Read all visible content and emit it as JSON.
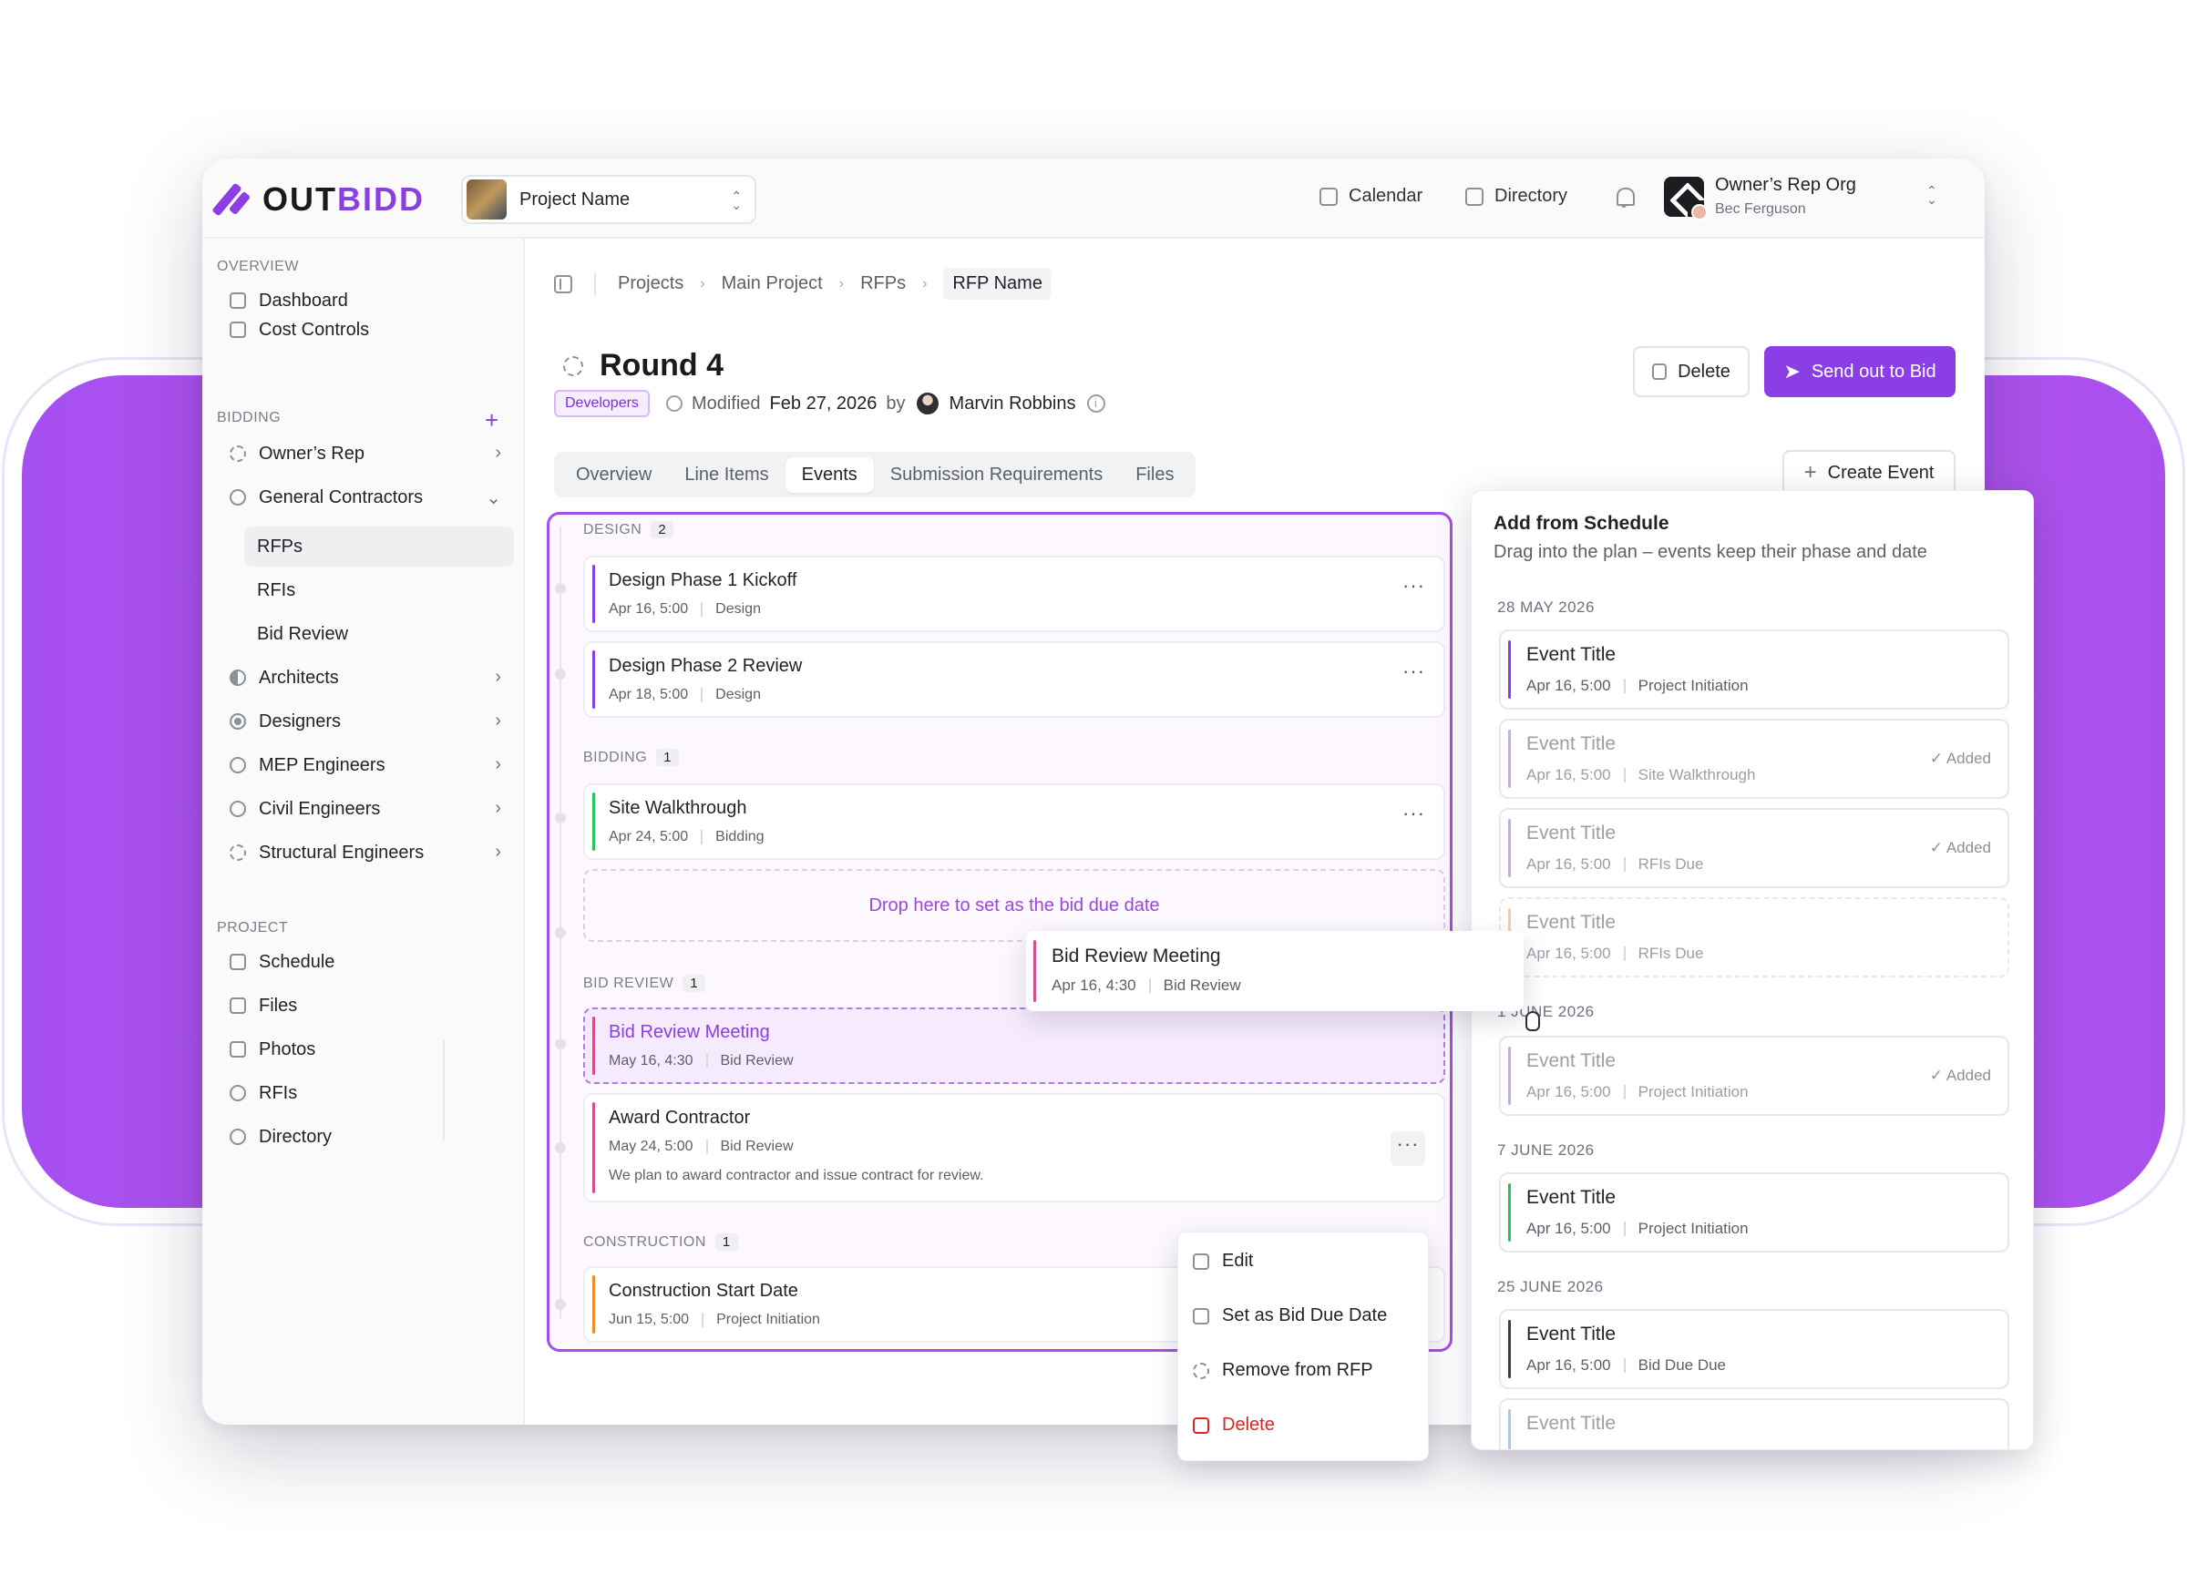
{
  "app": {
    "logo_prefix": "OUT",
    "logo_suffix": "BIDD",
    "accent": "#8b3de6"
  },
  "topbar": {
    "project": "Project Name",
    "calendar": "Calendar",
    "directory": "Directory",
    "org_name": "Owner’s Rep Org",
    "org_user": "Bec Ferguson"
  },
  "sidebar": {
    "overview_h": "OVERVIEW",
    "dashboard": "Dashboard",
    "cost_controls": "Cost Controls",
    "bidding_h": "BIDDING",
    "owners_rep": "Owner’s Rep",
    "general_contractors": "General Contractors",
    "rfps": "RFPs",
    "rfis": "RFIs",
    "bid_review": "Bid Review",
    "architects": "Architects",
    "designers": "Designers",
    "mep": "MEP Engineers",
    "civil": "Civil Engineers",
    "structural": "Structural Engineers",
    "project_h": "PROJECT",
    "schedule": "Schedule",
    "files": "Files",
    "photos": "Photos",
    "p_rfis": "RFIs",
    "p_directory": "Directory"
  },
  "breadcrumb": {
    "c1": "Projects",
    "c2": "Main Project",
    "c3": "RFPs",
    "c4": "RFP Name"
  },
  "header": {
    "title": "Round 4",
    "tag": "Developers",
    "modified_label": "Modified",
    "modified_date": "Feb 27, 2026",
    "by": "by",
    "author": "Marvin Robbins",
    "delete": "Delete",
    "send": "Send out to Bid",
    "create_event": "Create Event"
  },
  "tabs": {
    "overview": "Overview",
    "line_items": "Line Items",
    "events": "Events",
    "submission": "Submission Requirements",
    "files": "Files"
  },
  "board": {
    "design": {
      "label": "DESIGN",
      "count": "2"
    },
    "bidding": {
      "label": "BIDDING",
      "count": "1"
    },
    "bid_review": {
      "label": "BID REVIEW",
      "count": "1"
    },
    "construction": {
      "label": "CONSTRUCTION",
      "count": "1"
    },
    "e1": {
      "title": "Design Phase 1 Kickoff",
      "date": "Apr 16, 5:00",
      "phase": "Design"
    },
    "e2": {
      "title": "Design Phase 2 Review",
      "date": "Apr 18, 5:00",
      "phase": "Design"
    },
    "e3": {
      "title": "Site Walkthrough",
      "date": "Apr 24, 5:00",
      "phase": "Bidding"
    },
    "drop": "Drop here to set as the bid due date",
    "e4": {
      "title": "Bid Review Meeting",
      "date": "May 16, 4:30",
      "phase": "Bid Review"
    },
    "e5": {
      "title": "Award Contractor",
      "date": "May 24, 5:00",
      "phase": "Bid Review",
      "desc": "We plan to award contractor and issue contract for review."
    },
    "e6": {
      "title": "Construction Start Date",
      "date": "Jun 15, 5:00",
      "phase": "Project Initiation"
    },
    "ghost": {
      "title": "Bid Review Meeting",
      "date": "Apr 16, 4:30",
      "phase": "Bid Review"
    }
  },
  "menu": {
    "edit": "Edit",
    "set_bid": "Set as Bid Due Date",
    "remove": "Remove from RFP",
    "delete": "Delete"
  },
  "schedule": {
    "title": "Add from Schedule",
    "subtitle": "Drag into the plan – events keep their phase and date",
    "d1": "28 MAY 2026",
    "d2": "1 JUNE 2026",
    "d3": "7 JUNE 2026",
    "d4": "25 JUNE 2026",
    "added": "Added",
    "s1": {
      "title": "Event Title",
      "date": "Apr 16, 5:00",
      "phase": "Project Initiation"
    },
    "s2": {
      "title": "Event Title",
      "date": "Apr 16, 5:00",
      "phase": "Site Walkthrough"
    },
    "s3": {
      "title": "Event Title",
      "date": "Apr 16, 5:00",
      "phase": "RFIs Due"
    },
    "s4": {
      "title": "Event Title",
      "date": "Apr 16, 5:00",
      "phase": "RFIs Due"
    },
    "s5": {
      "title": "Event Title",
      "date": "Apr 16, 5:00",
      "phase": "Project Initiation"
    },
    "s6": {
      "title": "Event Title",
      "date": "Apr 16, 5:00",
      "phase": "Project Initiation"
    },
    "s7": {
      "title": "Event Title",
      "date": "Apr 16, 5:00",
      "phase": "Bid Due Due"
    },
    "s8": {
      "title": "Event Title"
    }
  }
}
